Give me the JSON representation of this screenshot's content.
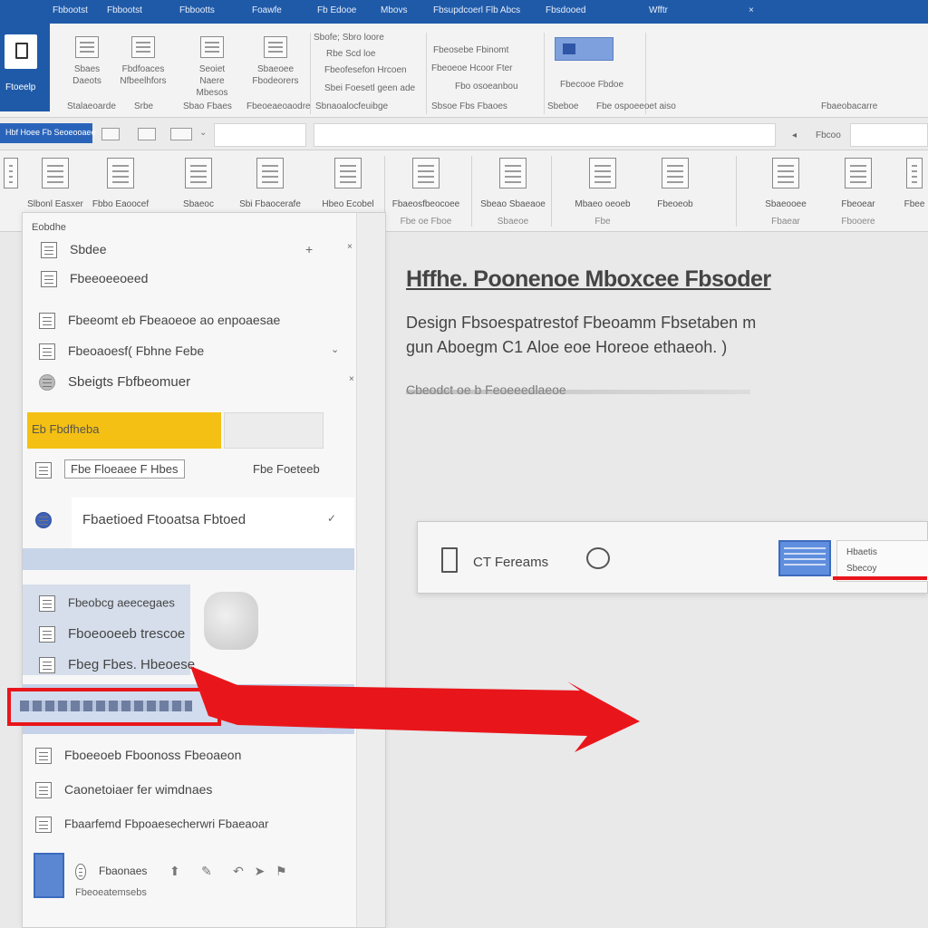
{
  "menu": {
    "tabs": [
      "Fbbootst",
      "Fbbootts",
      "Foawfe",
      "Fb Edooe",
      "Mbovs",
      "Fbsupdcoerl Flb Abcs",
      "Fbsdooed",
      "Wfftr"
    ]
  },
  "ribbon": {
    "file_label": "Ftoeelp",
    "items": [
      {
        "label": "Sbaes",
        "sub": "Daeots"
      },
      {
        "label": "Fbdfoaces",
        "sub": "Nfbeelhfors"
      },
      {
        "label": "Seoiet",
        "sub": "Naere Mbesos"
      },
      {
        "label": "Sbaeoee",
        "sub": "Fbodeorers"
      }
    ],
    "text_lines": [
      "Sbofe; Sbro loore",
      "Rbe Scd loe",
      "Fbeofesefon Hrcoen",
      "Sbei Foesetl geen ade"
    ],
    "text_lines2": [
      "Fbeosebe Fbinomt",
      "Fbeoeoe Hcoor Fter",
      "Fbo osoeanbou"
    ],
    "extra_label": "Fbecooe Fbdoe",
    "group_labels": [
      "Stalaeoarde",
      "Srbe",
      "Sbao Fbaes",
      "Fbeoeaeoaodre",
      "Sbnaoalocfeuibge",
      "Sbsoe Fbs Fbaoes",
      "Sbeboe",
      "Fbe ospoeeoet aiso",
      "Fbaeobacarre"
    ]
  },
  "toolbar": {
    "name_box": "Hbf Hoee Fb Seoeooaee",
    "right_label": "Fbcoo"
  },
  "ribbon2": {
    "items": [
      {
        "label": "Slbonl Easxer",
        "sub": ""
      },
      {
        "label": "Fbbo Eaoocef",
        "sub": ""
      },
      {
        "label": "Sbaeoc",
        "sub": ""
      },
      {
        "label": "Sbi Fbaocerafe",
        "sub": ""
      },
      {
        "label": "Hbeo Ecobel",
        "sub": ""
      },
      {
        "label": "Fbaeosfbeocoee",
        "sub": "Fbe oe Fboe"
      },
      {
        "label": "Sbeao Sbaeaoe",
        "sub": "Sbaeoe"
      },
      {
        "label": "Mbaeo oeoeb",
        "sub": "Fbe"
      },
      {
        "label": "Fbeoeob",
        "sub": ""
      },
      {
        "label": "Sbaeooee",
        "sub": "Fbaear"
      },
      {
        "label": "Fbeoear",
        "sub": "Fbooere"
      },
      {
        "label": "Fbee",
        "sub": ""
      }
    ]
  },
  "pane": {
    "header": "Eobdhe",
    "rows": [
      "Sbdee",
      "Fbeeoeeoeed",
      "Fbeeomt eb Fbeaoeoe ao enpoaesae",
      "Fbeoaoesf(  Fbhne Febe",
      "Sbeigts Fbfbeomuer",
      "Eb Fbdfheba",
      "Fbe Floeaee F Hbes",
      "Fbe Foeteeb",
      "Fbaetioed Ftooatsa Fbtoed",
      "Fbeobcg aeecegaes",
      "Fboeooeeb trescoe",
      "Fbeg Fbes. Hbeoese",
      "Fboeeoeb Fboonoss Fbeoaeon",
      "Caonetoiaer fer wimdnaes",
      "Fbaarfemd Fbpoaesecherwri Fbaeaoar",
      "Fbaonaes",
      "Fbeoeatemsebs"
    ]
  },
  "document": {
    "title": "Hffhe. Poonenoe Mboxcee Fbsoder",
    "line1": "Design  Fbsoespatrestof  Fbeoamm   Fbsetaben m",
    "line2": "gun Aboegm C1 Aloe eoe Horeoe ethaeoh. )",
    "link": "Cbeodct oe b Feoeeedlaeoe",
    "card_label": "CT Fereams",
    "card_mini_top": "Hbaetis",
    "card_mini_bottom": "Sbecoy"
  },
  "colors": {
    "titlebar": "#1f5aa8",
    "accent_yellow": "#f4c013",
    "arrow_red": "#e8161b"
  }
}
